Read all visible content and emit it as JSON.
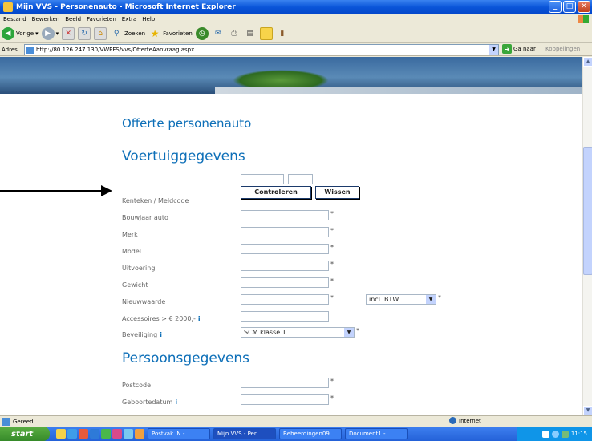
{
  "window": {
    "title": "Mijn VVS - Personenauto - Microsoft Internet Explorer",
    "min": "_",
    "max": "□",
    "close": "✕"
  },
  "menu": [
    "Bestand",
    "Bewerken",
    "Beeld",
    "Favorieten",
    "Extra",
    "Help"
  ],
  "toolbar": {
    "back_label": "Vorige",
    "search_label": "Zoeken",
    "favorites_label": "Favorieten"
  },
  "address": {
    "label": "Adres",
    "url": "http://80.126.247.130/VWPFS/vvs/OfferteAanvraag.aspx",
    "go_label": "Ga naar",
    "links_label": "Koppelingen"
  },
  "page": {
    "title": "Offerte personenauto",
    "section_vehicle": "Voertuiggegevens",
    "section_person": "Persoonsgegevens",
    "fields": {
      "kenteken": "Kenteken / Meldcode",
      "bouwjaar": "Bouwjaar auto",
      "merk": "Merk",
      "model": "Model",
      "uitvoering": "Uitvoering",
      "gewicht": "Gewicht",
      "nieuwwaarde": "Nieuwwaarde",
      "accessoires": "Accessoires > € 2000,-",
      "beveiliging": "Beveiliging",
      "postcode": "Postcode",
      "geboortedatum": "Geboortedatum"
    },
    "buttons": {
      "controleren": "Controleren",
      "wissen": "Wissen"
    },
    "btw_select": "incl. BTW",
    "beveiliging_select": "SCM klasse 1",
    "required_mark": "*",
    "info_mark": "i"
  },
  "status": {
    "text": "Gereed",
    "zone": "Internet"
  },
  "taskbar": {
    "start": "start",
    "tasks": [
      "Postvak IN - ...",
      "Mijn VVS - Per...",
      "Beheerdingen09",
      "Document1 - ..."
    ],
    "clock": "11:15"
  },
  "colors": {
    "accent": "#0d6fb8",
    "xp_blue": "#0a55d9"
  }
}
